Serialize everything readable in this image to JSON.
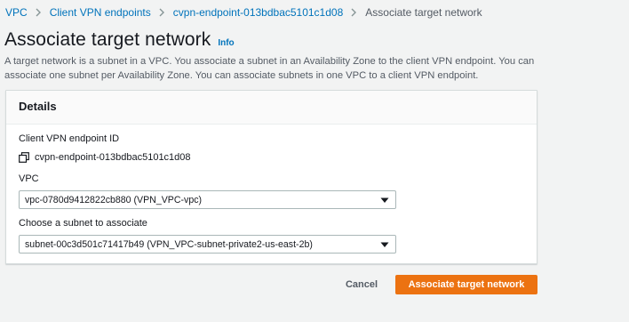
{
  "breadcrumb": {
    "items": [
      "VPC",
      "Client VPN endpoints",
      "cvpn-endpoint-013bdbac5101c1d08"
    ],
    "current": "Associate target network"
  },
  "header": {
    "title": "Associate target network",
    "info": "Info",
    "description": "A target network is a subnet in a VPC. You associate a subnet in an Availability Zone to the client VPN endpoint. You can associate one subnet per Availability Zone. You can associate subnets in one VPC to a client VPN endpoint."
  },
  "details": {
    "title": "Details",
    "endpoint_label": "Client VPN endpoint ID",
    "endpoint_value": "cvpn-endpoint-013bdbac5101c1d08",
    "vpc_label": "VPC",
    "vpc_value": "vpc-0780d9412822cb880 (VPN_VPC-vpc)",
    "subnet_label": "Choose a subnet to associate",
    "subnet_value": "subnet-00c3d501c71417b49 (VPN_VPC-subnet-private2-us-east-2b)"
  },
  "actions": {
    "cancel": "Cancel",
    "submit": "Associate target network"
  },
  "colors": {
    "link": "#0073bb",
    "primary": "#ec7211",
    "background": "#f2f3f3"
  }
}
